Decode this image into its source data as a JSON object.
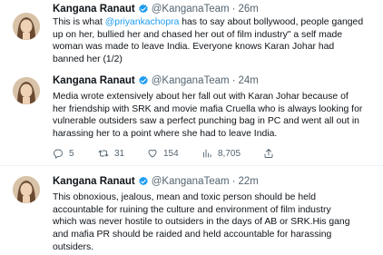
{
  "colors": {
    "text": "#0f1419",
    "secondary": "#536471",
    "link": "#1d9bf0",
    "verified": "#1d9bf0",
    "divider": "#eff3f4"
  },
  "tweets": [
    {
      "name": "Kangana Ranaut",
      "handle": "@KanganaTeam",
      "dot": "·",
      "time": "26m",
      "text_pre": "This is what ",
      "mention": "@priyankachopra",
      "text_post": " has to say about bollywood, people ganged\nup on her, bullied her and chased her out of film industry\" a self made\nwoman was made to leave India. Everyone knows Karan Johar had\nbanned her (1/2)",
      "icons": {
        "avatar": "avatar-icon",
        "verified": "verified-badge-icon"
      }
    },
    {
      "name": "Kangana Ranaut",
      "handle": "@KanganaTeam",
      "dot": "·",
      "time": "24m",
      "text": "Media wrote extensively about her fall out with Karan Johar because of\nher friendship with SRK and movie mafia Cruella who is always looking for\nvulnerable outsiders saw a perfect punching bag in PC and went all out in\nharassing her to a point where she had to leave India.",
      "actions": {
        "replies": "5",
        "retweets": "31",
        "likes": "154",
        "views": "8,705"
      },
      "icons": {
        "reply": "reply-icon",
        "retweet": "retweet-icon",
        "like": "heart-icon",
        "views": "views-icon",
        "share": "share-icon"
      }
    },
    {
      "name": "Kangana Ranaut",
      "handle": "@KanganaTeam",
      "dot": "·",
      "time": "22m",
      "text": "This obnoxious, jealous, mean and toxic person should be held\naccountable for ruining the culture and environment of film industry\nwhich was never hostile to outsiders in the days of AB or SRK.His gang\nand mafia PR should be raided and held accountable for harassing\noutsiders."
    }
  ]
}
